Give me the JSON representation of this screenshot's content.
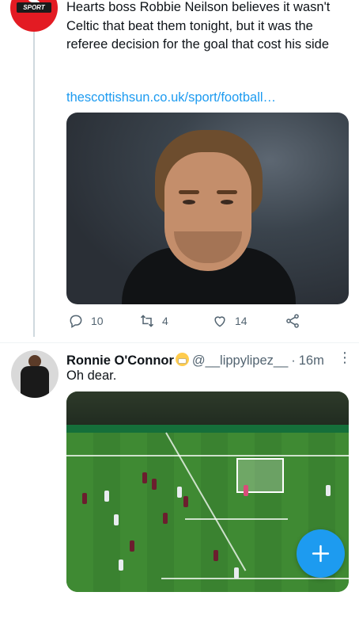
{
  "tweet1": {
    "avatar_label": "SPORT",
    "text": "Hearts boss Robbie Neilson believes it wasn't Celtic that beat them tonight, but it was the referee decision for the goal that cost his side",
    "link": "thescottishsun.co.uk/sport/football…",
    "actions": {
      "replies": "10",
      "retweets": "4",
      "likes": "14"
    }
  },
  "tweet2": {
    "display_name": "Ronnie O'Connor",
    "handle": "@__lippylipez__",
    "separator": "·",
    "timestamp": "16m",
    "text": "Oh dear."
  },
  "colors": {
    "accent": "#1d9bf0",
    "secondary_text": "#536471",
    "brand_red": "#e31b23"
  },
  "icons": [
    "reply-icon",
    "retweet-icon",
    "like-icon",
    "share-icon",
    "more-icon",
    "compose-plus-icon"
  ]
}
